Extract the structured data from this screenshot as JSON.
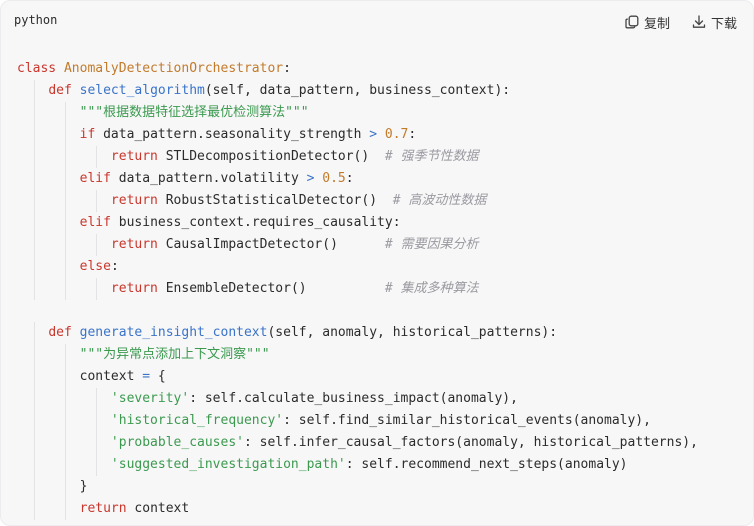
{
  "header": {
    "language": "python",
    "copy_label": "复制",
    "download_label": "下载",
    "copy_icon": "copy-icon",
    "download_icon": "download-icon"
  },
  "code_lines": [
    [
      [
        "kw",
        "class "
      ],
      [
        "cls",
        "AnomalyDetectionOrchestrator"
      ],
      [
        "pl",
        ":"
      ]
    ],
    [
      [
        "pl",
        "    "
      ],
      [
        "kw",
        "def "
      ],
      [
        "fn",
        "select_algorithm"
      ],
      [
        "pl",
        "(self, data_pattern, business_context):"
      ]
    ],
    [
      [
        "pl",
        "        "
      ],
      [
        "str",
        "\"\"\"根据数据特征选择最优检测算法\"\"\""
      ]
    ],
    [
      [
        "pl",
        "        "
      ],
      [
        "kw",
        "if "
      ],
      [
        "pl",
        "data_pattern.seasonality_strength "
      ],
      [
        "op",
        ">"
      ],
      [
        "pl",
        " "
      ],
      [
        "num",
        "0.7"
      ],
      [
        "pl",
        ":"
      ]
    ],
    [
      [
        "pl",
        "            "
      ],
      [
        "kw",
        "return "
      ],
      [
        "pl",
        "STLDecompositionDetector()  "
      ],
      [
        "cmt",
        "# 强季节性数据"
      ]
    ],
    [
      [
        "pl",
        "        "
      ],
      [
        "kw",
        "elif "
      ],
      [
        "pl",
        "data_pattern.volatility "
      ],
      [
        "op",
        ">"
      ],
      [
        "pl",
        " "
      ],
      [
        "num",
        "0.5"
      ],
      [
        "pl",
        ":"
      ]
    ],
    [
      [
        "pl",
        "            "
      ],
      [
        "kw",
        "return "
      ],
      [
        "pl",
        "RobustStatisticalDetector()  "
      ],
      [
        "cmt",
        "# 高波动性数据"
      ]
    ],
    [
      [
        "pl",
        "        "
      ],
      [
        "kw",
        "elif "
      ],
      [
        "pl",
        "business_context.requires_causality:"
      ]
    ],
    [
      [
        "pl",
        "            "
      ],
      [
        "kw",
        "return "
      ],
      [
        "pl",
        "CausalImpactDetector()      "
      ],
      [
        "cmt",
        "# 需要因果分析"
      ]
    ],
    [
      [
        "pl",
        "        "
      ],
      [
        "kw",
        "else"
      ],
      [
        "pl",
        ":"
      ]
    ],
    [
      [
        "pl",
        "            "
      ],
      [
        "kw",
        "return "
      ],
      [
        "pl",
        "EnsembleDetector()          "
      ],
      [
        "cmt",
        "# 集成多种算法"
      ]
    ],
    [],
    [
      [
        "pl",
        "    "
      ],
      [
        "kw",
        "def "
      ],
      [
        "fn",
        "generate_insight_context"
      ],
      [
        "pl",
        "(self, anomaly, historical_patterns):"
      ]
    ],
    [
      [
        "pl",
        "        "
      ],
      [
        "str",
        "\"\"\"为异常点添加上下文洞察\"\"\""
      ]
    ],
    [
      [
        "pl",
        "        context "
      ],
      [
        "op",
        "="
      ],
      [
        "pl",
        " {"
      ]
    ],
    [
      [
        "pl",
        "            "
      ],
      [
        "str",
        "'severity'"
      ],
      [
        "pl",
        ": self.calculate_business_impact(anomaly),"
      ]
    ],
    [
      [
        "pl",
        "            "
      ],
      [
        "str",
        "'historical_frequency'"
      ],
      [
        "pl",
        ": self.find_similar_historical_events(anomaly),"
      ]
    ],
    [
      [
        "pl",
        "            "
      ],
      [
        "str",
        "'probable_causes'"
      ],
      [
        "pl",
        ": self.infer_causal_factors(anomaly, historical_patterns),"
      ]
    ],
    [
      [
        "pl",
        "            "
      ],
      [
        "str",
        "'suggested_investigation_path'"
      ],
      [
        "pl",
        ": self.recommend_next_steps(anomaly)"
      ]
    ],
    [
      [
        "pl",
        "        }"
      ]
    ],
    [
      [
        "pl",
        "        "
      ],
      [
        "kw",
        "return "
      ],
      [
        "pl",
        "context"
      ]
    ]
  ]
}
